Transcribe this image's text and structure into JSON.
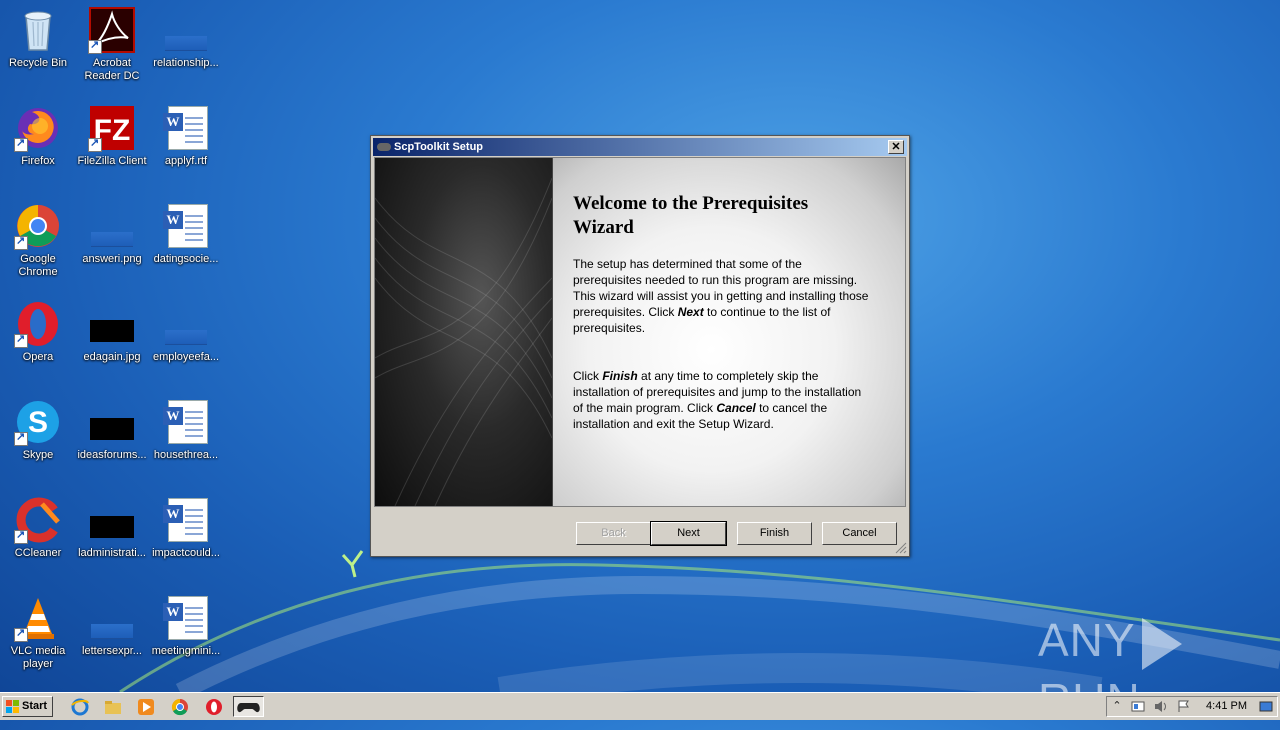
{
  "desktop": {
    "icons": [
      {
        "label": "Recycle Bin"
      },
      {
        "label": "Acrobat Reader DC"
      },
      {
        "label": "relationship..."
      },
      {
        "label": "Firefox"
      },
      {
        "label": "FileZilla Client"
      },
      {
        "label": "applyf.rtf"
      },
      {
        "label": "Google Chrome"
      },
      {
        "label": "answeri.png"
      },
      {
        "label": "datingsocie..."
      },
      {
        "label": "Opera"
      },
      {
        "label": "edagain.jpg"
      },
      {
        "label": "employeefa..."
      },
      {
        "label": "Skype"
      },
      {
        "label": "ideasforums..."
      },
      {
        "label": "housethrea..."
      },
      {
        "label": "CCleaner"
      },
      {
        "label": "ladministrati..."
      },
      {
        "label": "impactcould..."
      },
      {
        "label": "VLC media player"
      },
      {
        "label": "lettersexpr..."
      },
      {
        "label": "meetingmini..."
      }
    ]
  },
  "dialog": {
    "title": "ScpToolkit Setup",
    "close_glyph": "✕",
    "heading": "Welcome to the Prerequisites Wizard",
    "para1_a": "The setup has determined that some of the prerequisites needed to run this program are missing. This wizard will assist you in getting and installing those prerequisites. Click ",
    "para1_em": "Next",
    "para1_b": "  to continue to the list of prerequisites.",
    "para2_a": "Click ",
    "para2_em1": "Finish",
    "para2_b": " at any time to completely skip the installation of prerequisites and jump to the installation of the main program. Click ",
    "para2_em2": "Cancel",
    "para2_c": " to cancel the installation and exit the Setup Wizard.",
    "buttons": {
      "back": "Back",
      "next": "Next",
      "finish": "Finish",
      "cancel": "Cancel"
    }
  },
  "watermark": {
    "left": "ANY",
    "right": "RUN"
  },
  "taskbar": {
    "start_label": "Start",
    "clock": "4:41 PM",
    "tray_chevron": "⌃"
  },
  "colors": {
    "titlebar_start": "#0a246a",
    "titlebar_end": "#a6caf0",
    "desktop_blue": "#1b5fb7"
  }
}
